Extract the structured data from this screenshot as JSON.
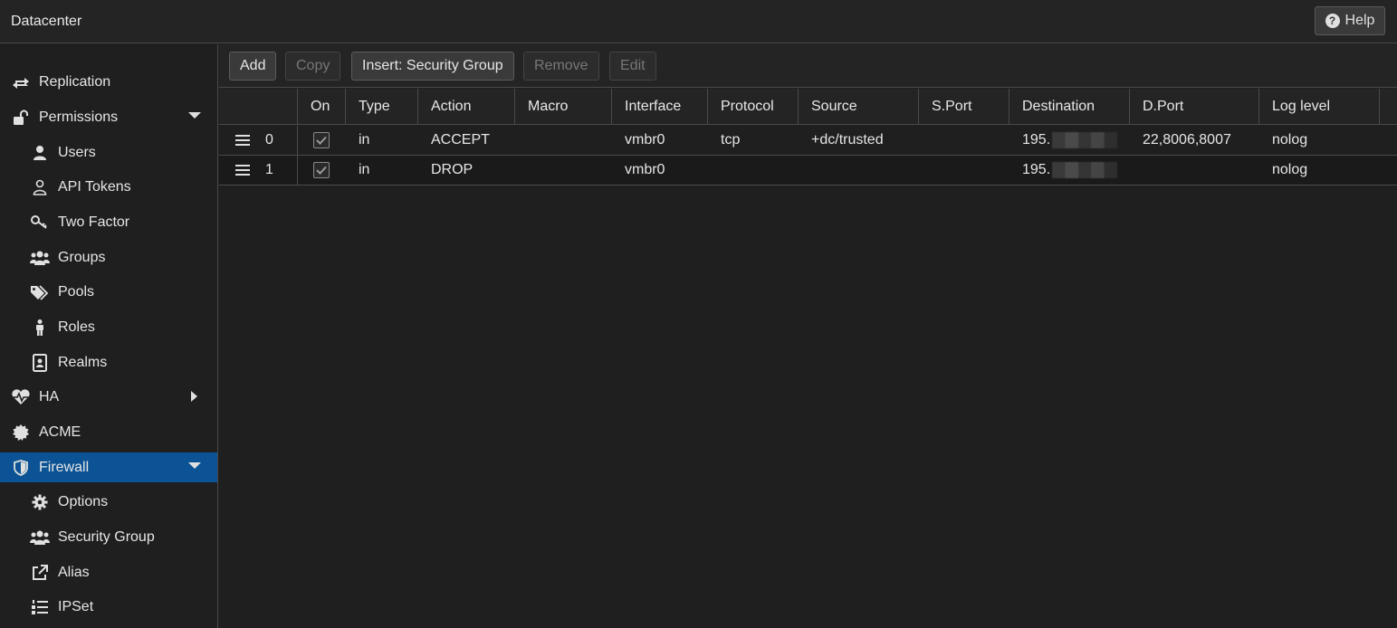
{
  "header": {
    "title": "Datacenter",
    "help_label": "Help"
  },
  "sidebar": {
    "items": [
      {
        "label": "Replication",
        "icon": "replication-icon",
        "level": 0
      },
      {
        "label": "Permissions",
        "icon": "unlock-icon",
        "level": 0,
        "expanded": true
      },
      {
        "label": "Users",
        "icon": "user-icon",
        "level": 1
      },
      {
        "label": "API Tokens",
        "icon": "user-outline-icon",
        "level": 1
      },
      {
        "label": "Two Factor",
        "icon": "key-icon",
        "level": 1
      },
      {
        "label": "Groups",
        "icon": "users-icon",
        "level": 1
      },
      {
        "label": "Pools",
        "icon": "tags-icon",
        "level": 1
      },
      {
        "label": "Roles",
        "icon": "male-icon",
        "level": 1
      },
      {
        "label": "Realms",
        "icon": "address-book-icon",
        "level": 1
      },
      {
        "label": "HA",
        "icon": "heartbeat-icon",
        "level": 0,
        "expanded": false
      },
      {
        "label": "ACME",
        "icon": "certificate-icon",
        "level": 0
      },
      {
        "label": "Firewall",
        "icon": "shield-icon",
        "level": 0,
        "expanded": true,
        "selected": true
      },
      {
        "label": "Options",
        "icon": "gear-icon",
        "level": 1
      },
      {
        "label": "Security Group",
        "icon": "users-icon",
        "level": 1
      },
      {
        "label": "Alias",
        "icon": "external-link-icon",
        "level": 1
      },
      {
        "label": "IPSet",
        "icon": "list-ol-icon",
        "level": 1
      }
    ]
  },
  "toolbar": {
    "add": "Add",
    "copy": "Copy",
    "insert_security_group": "Insert: Security Group",
    "remove": "Remove",
    "edit": "Edit"
  },
  "grid": {
    "columns": [
      "On",
      "Type",
      "Action",
      "Macro",
      "Interface",
      "Protocol",
      "Source",
      "S.Port",
      "Destination",
      "D.Port",
      "Log level"
    ],
    "rows": [
      {
        "index": "0",
        "on": true,
        "type": "in",
        "action": "ACCEPT",
        "macro": "",
        "interface": "vmbr0",
        "protocol": "tcp",
        "source": "+dc/trusted",
        "sport": "",
        "destination": "195.",
        "dport": "22,8006,8007",
        "log": "nolog"
      },
      {
        "index": "1",
        "on": true,
        "type": "in",
        "action": "DROP",
        "macro": "",
        "interface": "vmbr0",
        "protocol": "",
        "source": "",
        "sport": "",
        "destination": "195.",
        "dport": "",
        "log": "nolog"
      }
    ]
  },
  "colors": {
    "background": "#1f1f1f",
    "selected": "#0b5394",
    "border": "#4a4a4a"
  }
}
